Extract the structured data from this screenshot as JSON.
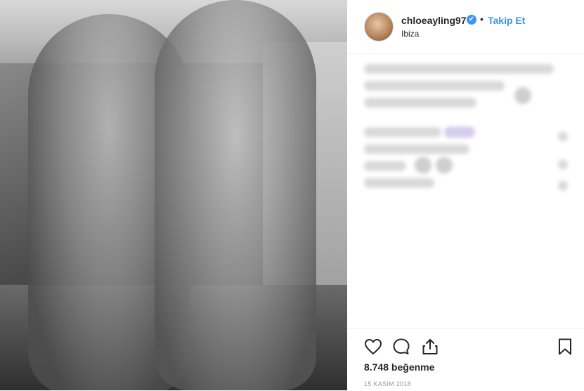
{
  "post": {
    "username": "chloeayling97",
    "verified_mark": "✔",
    "separator": "•",
    "follow_label": "Takip Et",
    "location": "Ibiza",
    "likes": "8.748 beğenme",
    "date": "15 KASIM 2018"
  },
  "icons": [
    "heart-icon",
    "comment-icon",
    "share-icon",
    "bookmark-icon"
  ],
  "colors": {
    "link_blue": "#3897f0",
    "text": "#262626",
    "muted": "#999999"
  }
}
